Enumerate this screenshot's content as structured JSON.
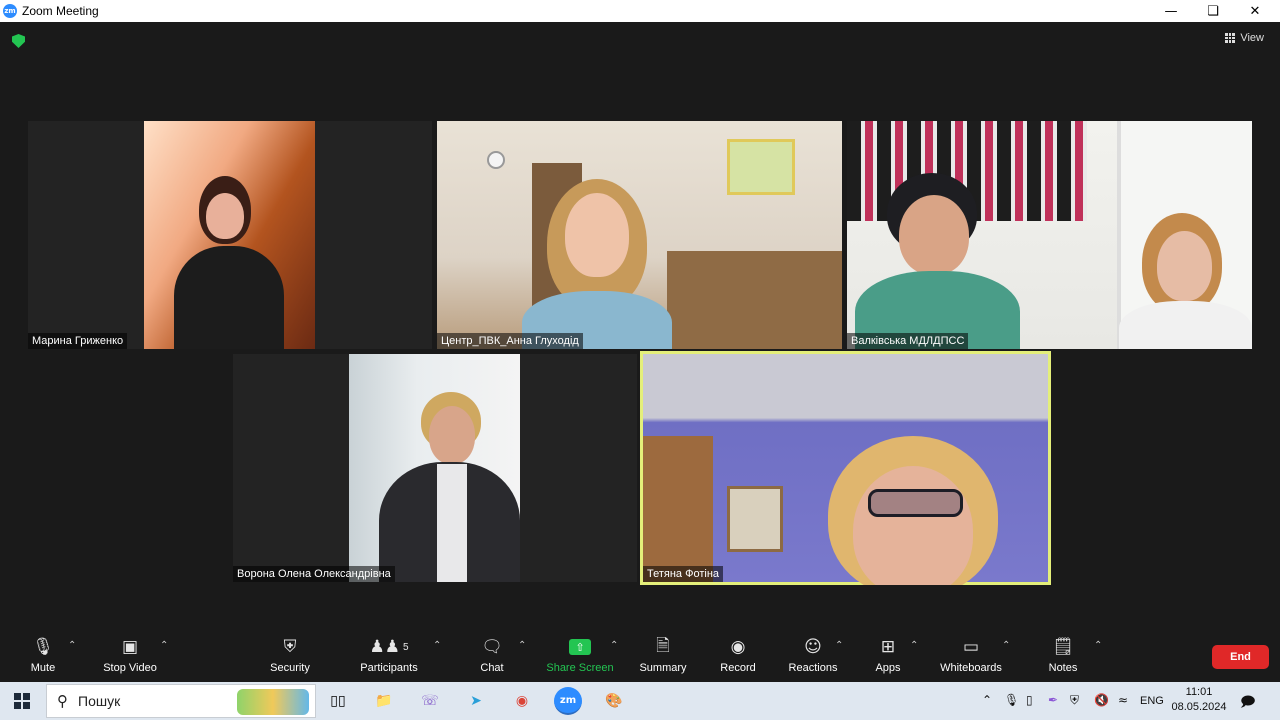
{
  "window": {
    "title": "Zoom Meeting",
    "app_icon": "zm",
    "controls": [
      "minimize-icon",
      "restore-icon",
      "close-icon"
    ]
  },
  "meeting": {
    "view_label": "View",
    "encryption_icon": "shield-check-icon",
    "participants": [
      {
        "name": "Марина Гриженко"
      },
      {
        "name": "Центр_ПВК_Анна Глуходід"
      },
      {
        "name": "Валківська МДЛДПСС"
      },
      {
        "name": "Ворона Олена Олександрівна"
      },
      {
        "name": "Тетяна Фотіна",
        "active_speaker": true
      }
    ]
  },
  "toolbar": {
    "mute": "Mute",
    "stop_video": "Stop Video",
    "security": "Security",
    "participants": "Participants",
    "participants_count": "5",
    "chat": "Chat",
    "share_screen": "Share Screen",
    "summary": "Summary",
    "record": "Record",
    "reactions": "Reactions",
    "apps": "Apps",
    "whiteboards": "Whiteboards",
    "notes": "Notes",
    "end": "End"
  },
  "colors": {
    "accent_green": "#23c552",
    "end_red": "#e02828",
    "active_speaker_border": "#e4ef7a",
    "background": "#1a1a1a"
  },
  "taskbar": {
    "search_placeholder": "Пошук",
    "language": "ENG",
    "time": "11:01",
    "date": "08.05.2024"
  }
}
